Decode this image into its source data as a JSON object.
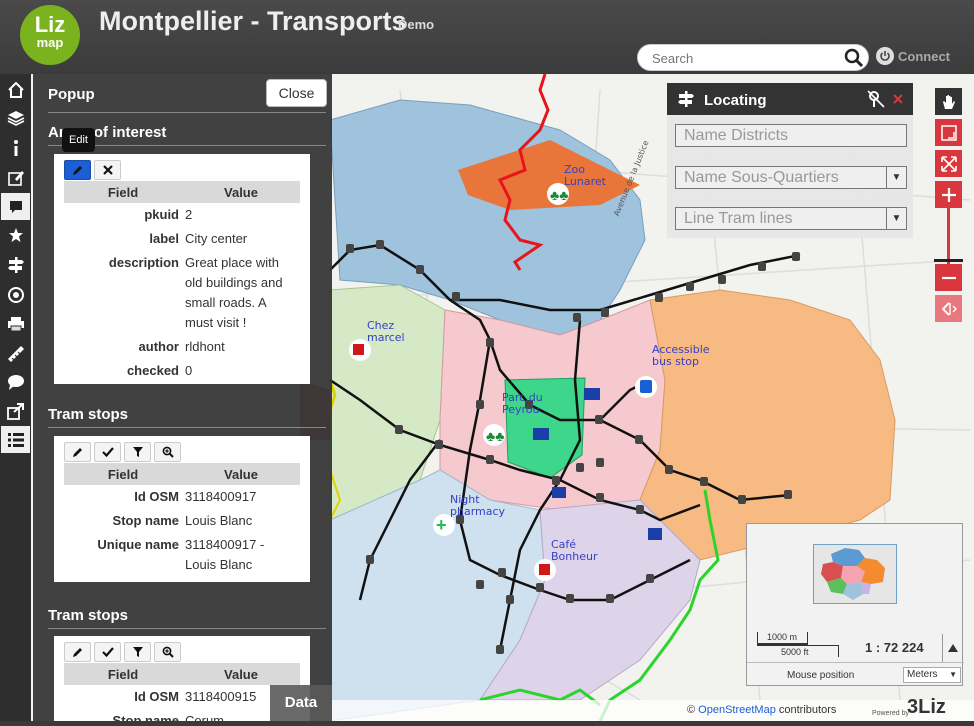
{
  "header": {
    "logo_top": "Liz",
    "logo_bottom": "map",
    "title": "Montpellier - Transports",
    "subtitle": "Demo",
    "search_placeholder": "Search",
    "connect_label": "Connect"
  },
  "toolbar": {
    "items": [
      {
        "name": "home-icon"
      },
      {
        "name": "layers-icon"
      },
      {
        "name": "info-icon"
      },
      {
        "name": "edit-icon"
      },
      {
        "name": "popup-icon"
      },
      {
        "name": "star-icon"
      },
      {
        "name": "locate-icon"
      },
      {
        "name": "geolocation-icon"
      },
      {
        "name": "print-icon"
      },
      {
        "name": "measure-icon"
      },
      {
        "name": "comment-icon"
      },
      {
        "name": "share-icon"
      },
      {
        "name": "list-icon"
      }
    ]
  },
  "popup": {
    "title": "Popup",
    "close_label": "Close",
    "tooltip": "Edit",
    "field_header": "Field",
    "value_header": "Value",
    "sections": [
      {
        "title": "Areas of interest",
        "rows": [
          {
            "k": "pkuid",
            "v": "2"
          },
          {
            "k": "label",
            "v": "City center"
          },
          {
            "k": "description",
            "v": "Great place with old buildings and small roads. A must visit !"
          },
          {
            "k": "author",
            "v": "rldhont"
          },
          {
            "k": "checked",
            "v": "0"
          }
        ]
      },
      {
        "title": "Tram stops",
        "rows": [
          {
            "k": "Id OSM",
            "v": "3118400917"
          },
          {
            "k": "Stop name",
            "v": "Louis Blanc"
          },
          {
            "k": "Unique name",
            "v": "3118400917 - Louis Blanc"
          }
        ]
      },
      {
        "title": "Tram stops",
        "rows": [
          {
            "k": "Id OSM",
            "v": "3118400915"
          },
          {
            "k": "Stop name",
            "v": "Corum"
          }
        ]
      }
    ]
  },
  "locating": {
    "title": "Locating",
    "fields": [
      "Name Districts",
      "Name Sous-Quartiers",
      "Line Tram lines"
    ]
  },
  "map": {
    "labels": {
      "zoo": "Zoo Lunaret",
      "chez": "Chez marcel",
      "accessible": "Accessible bus stop",
      "parc": "Parc du Peyrou",
      "night": "Night pharmacy",
      "cafe": "Café Bonheur",
      "road": "Avenue de la Justice"
    }
  },
  "overview": {
    "scale_m": "1000 m",
    "scale_ft": "5000 ft",
    "scale": "1 : 72 224",
    "mouse_label": "Mouse position",
    "units": "Meters"
  },
  "bottom": {
    "data_tab": "Data",
    "attribution_prefix": "©",
    "attribution_link": "OpenStreetMap",
    "attribution_suffix": "contributors",
    "powered": "Powered by",
    "powered_logo": "3Liz"
  },
  "colors": {
    "accent": "#1a5fd6",
    "control_red": "#d9363e",
    "header": "#3b3b3b"
  }
}
